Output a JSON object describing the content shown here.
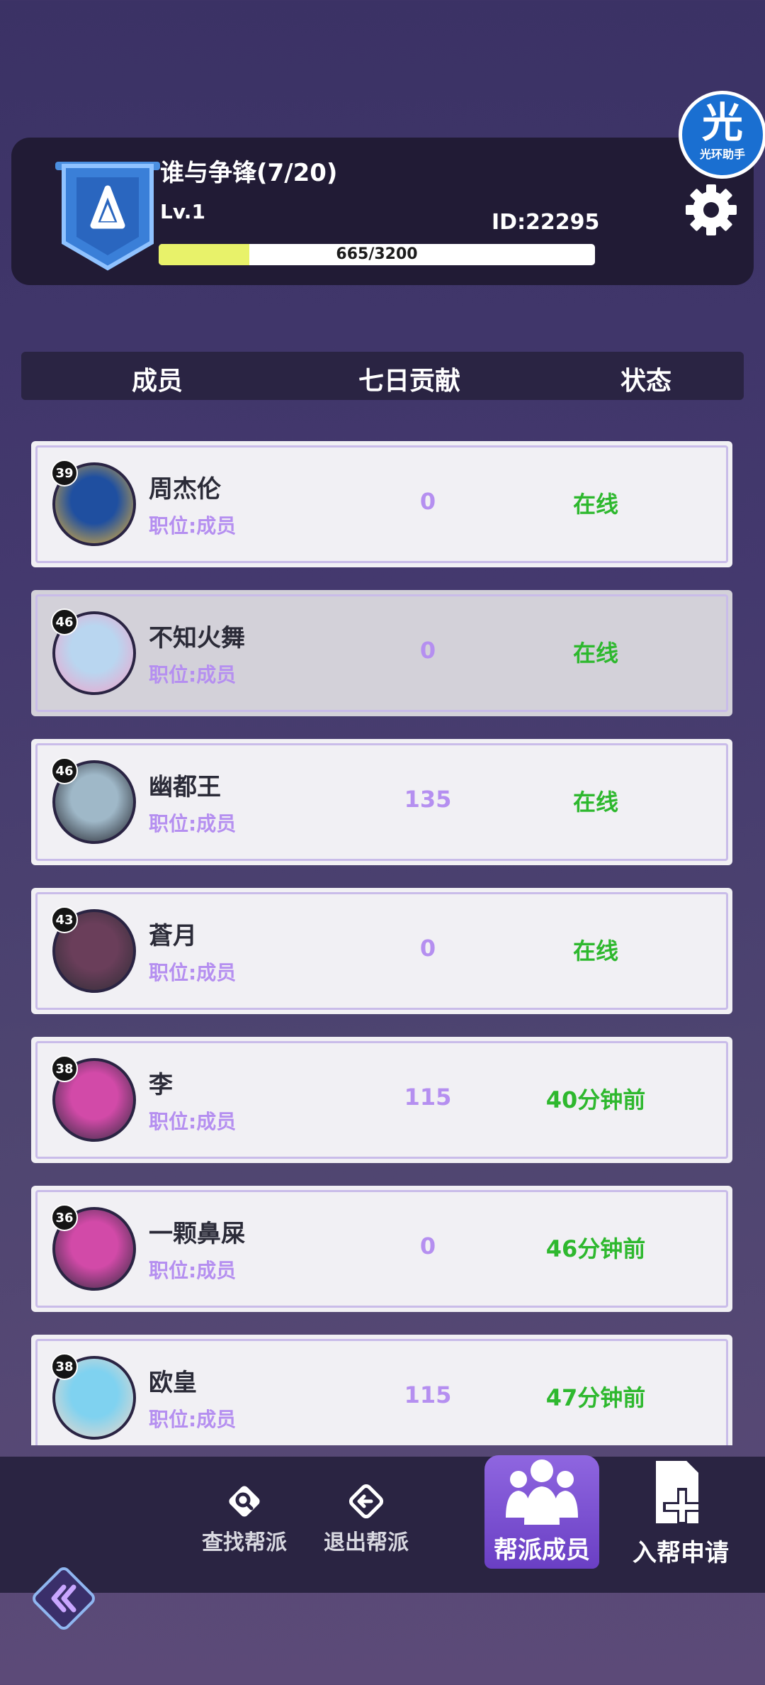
{
  "guild": {
    "name": "谁与争锋(7/20)",
    "level": "Lv.1",
    "id": "ID:22295",
    "xp_text": "665/3200",
    "xp_fraction": 0.208
  },
  "helper_badge": {
    "big": "光",
    "small": "光环助手"
  },
  "columns": {
    "member": "成员",
    "contribution": "七日贡献",
    "status": "状态"
  },
  "members": [
    {
      "level": "39",
      "name": "周杰伦",
      "role": "职位:成员",
      "contribution": "0",
      "status": "在线",
      "avatar": "golden-globe-icon"
    },
    {
      "level": "46",
      "name": "不知火舞",
      "role": "职位:成员",
      "contribution": "0",
      "status": "在线",
      "avatar": "pink-hair-girl-icon"
    },
    {
      "level": "46",
      "name": "幽都王",
      "role": "职位:成员",
      "contribution": "135",
      "status": "在线",
      "avatar": "masked-king-icon"
    },
    {
      "level": "43",
      "name": "蒼月",
      "role": "职位:成员",
      "contribution": "0",
      "status": "在线",
      "avatar": "dark-hair-robot-icon"
    },
    {
      "level": "38",
      "name": "李",
      "role": "职位:成员",
      "contribution": "115",
      "status": "40分钟前",
      "avatar": "space-helmet-icon"
    },
    {
      "level": "36",
      "name": "一颗鼻屎",
      "role": "职位:成员",
      "contribution": "0",
      "status": "46分钟前",
      "avatar": "space-helmet-icon"
    },
    {
      "level": "38",
      "name": "欧皇",
      "role": "职位:成员",
      "contribution": "115",
      "status": "47分钟前",
      "avatar": "blue-hair-girl-icon"
    }
  ],
  "nav": {
    "find": "查找帮派",
    "leave": "退出帮派",
    "members": "帮派成员",
    "apply": "入帮申请"
  },
  "colors": {
    "online": "#2eb82e",
    "accent_purple": "#b58ff0",
    "nav_active": "#7a4fd4"
  }
}
